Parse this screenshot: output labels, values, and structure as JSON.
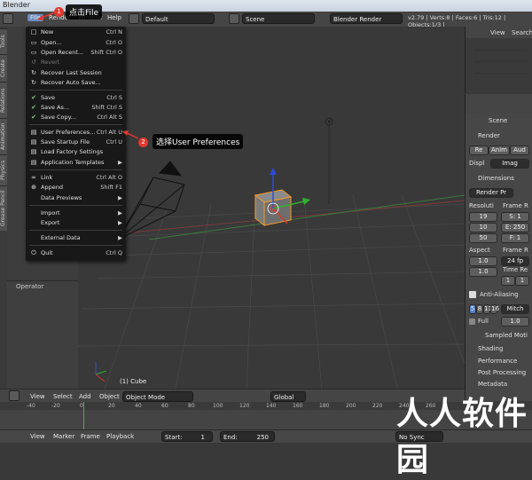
{
  "window": {
    "title": "Blender"
  },
  "infobar": {
    "menus": [
      "File",
      "Render",
      "Window",
      "Help"
    ],
    "screen_layout": "Default",
    "scene": "Scene",
    "engine": "Blender Render",
    "stats": "v2.79 | Verts:8 | Faces:6 | Tris:12 | Objects:1/3 |"
  },
  "file_menu": {
    "items": [
      {
        "label": "New",
        "shortcut": "Ctrl N",
        "icon": "new-file-icon"
      },
      {
        "label": "Open...",
        "shortcut": "Ctrl O",
        "icon": "open-folder-icon"
      },
      {
        "label": "Open Recent...",
        "shortcut": "Shift Ctrl O",
        "icon": "recent-icon"
      },
      {
        "label": "Revert",
        "shortcut": "",
        "icon": "revert-icon",
        "disabled": true
      },
      {
        "label": "Recover Last Session",
        "shortcut": "",
        "icon": "recover-icon"
      },
      {
        "label": "Recover Auto Save...",
        "shortcut": "",
        "icon": "recover-autosave-icon"
      },
      {
        "label": "Save",
        "shortcut": "Ctrl S",
        "icon": "save-icon"
      },
      {
        "label": "Save As...",
        "shortcut": "Shift Ctrl S",
        "icon": "save-as-icon"
      },
      {
        "label": "Save Copy...",
        "shortcut": "Ctrl Alt S",
        "icon": "save-copy-icon"
      },
      {
        "label": "User Preferences...",
        "shortcut": "Ctrl Alt U",
        "icon": "preferences-icon"
      },
      {
        "label": "Save Startup File",
        "shortcut": "Ctrl U",
        "icon": "startup-save-icon"
      },
      {
        "label": "Load Factory Settings",
        "shortcut": "",
        "icon": "factory-icon"
      },
      {
        "label": "Application Templates",
        "shortcut": "▶",
        "icon": "templates-icon"
      },
      {
        "label": "Link",
        "shortcut": "Ctrl Alt O",
        "icon": "link-icon"
      },
      {
        "label": "Append",
        "shortcut": "Shift F1",
        "icon": "append-icon"
      },
      {
        "label": "Data Previews",
        "shortcut": "▶",
        "icon": ""
      },
      {
        "label": "Import",
        "shortcut": "▶",
        "icon": ""
      },
      {
        "label": "Export",
        "shortcut": "▶",
        "icon": ""
      },
      {
        "label": "External Data",
        "shortcut": "▶",
        "icon": ""
      },
      {
        "label": "Quit",
        "shortcut": "Ctrl Q",
        "icon": "quit-icon"
      }
    ]
  },
  "annotations": {
    "step1_number": "1",
    "step1_text": "点击File",
    "step2_number": "2",
    "step2_text": "选择User Preferences"
  },
  "left_tabs": [
    "Tools",
    "Create",
    "Relations",
    "Animation",
    "Physics",
    "Grease Pencil"
  ],
  "operator_panel": {
    "title": "Operator"
  },
  "viewport": {
    "object_label": "(1) Cube"
  },
  "outliner": {
    "view_label": "View",
    "search_label": "Search"
  },
  "properties": {
    "scene_label": "Scene",
    "render_section": "Render",
    "render_buttons": [
      "Re",
      "Anim",
      "Aud"
    ],
    "display_label": "Displ",
    "display_value": "Imag",
    "dimensions_section": "Dimensions",
    "preset": "Render Pr",
    "resolution_label": "Resoluti",
    "frame_rate_label": "Frame R",
    "res_x": "19",
    "res_y": "10",
    "res_pct": "50",
    "frame_start": "S: 1",
    "frame_end": "E: 250",
    "frame_step": "F: 1",
    "aspect_label": "Aspect",
    "aspect_x": "1.0",
    "aspect_y": "1.0",
    "fps_label": "Frame R",
    "fps": "24 fp",
    "time_remap": "Time Re",
    "remap_old": "1",
    "remap_new": "1",
    "aa_label": "Anti-Aliasing",
    "aa_samples": [
      "5",
      "8",
      "11",
      "16"
    ],
    "aa_filter": "Mitch",
    "full_label": "Full",
    "full_value": "1.0",
    "sections": [
      "Sampled Moti",
      "Shading",
      "Performance",
      "Post Processing",
      "Metadata"
    ]
  },
  "view3d_header": {
    "menus": [
      "View",
      "Select",
      "Add",
      "Object"
    ],
    "mode": "Object Mode",
    "orientation": "Global"
  },
  "timeline": {
    "ticks": [
      "-40",
      "-20",
      "0",
      "20",
      "40",
      "60",
      "80",
      "100",
      "120",
      "140",
      "160",
      "180",
      "200",
      "220",
      "240",
      "260"
    ],
    "menus": [
      "View",
      "Marker",
      "Frame",
      "Playback"
    ],
    "start": "Start:",
    "start_value": "1",
    "end": "End:",
    "end_value": "250",
    "sync": "No Sync"
  },
  "watermark": "人人软件园"
}
